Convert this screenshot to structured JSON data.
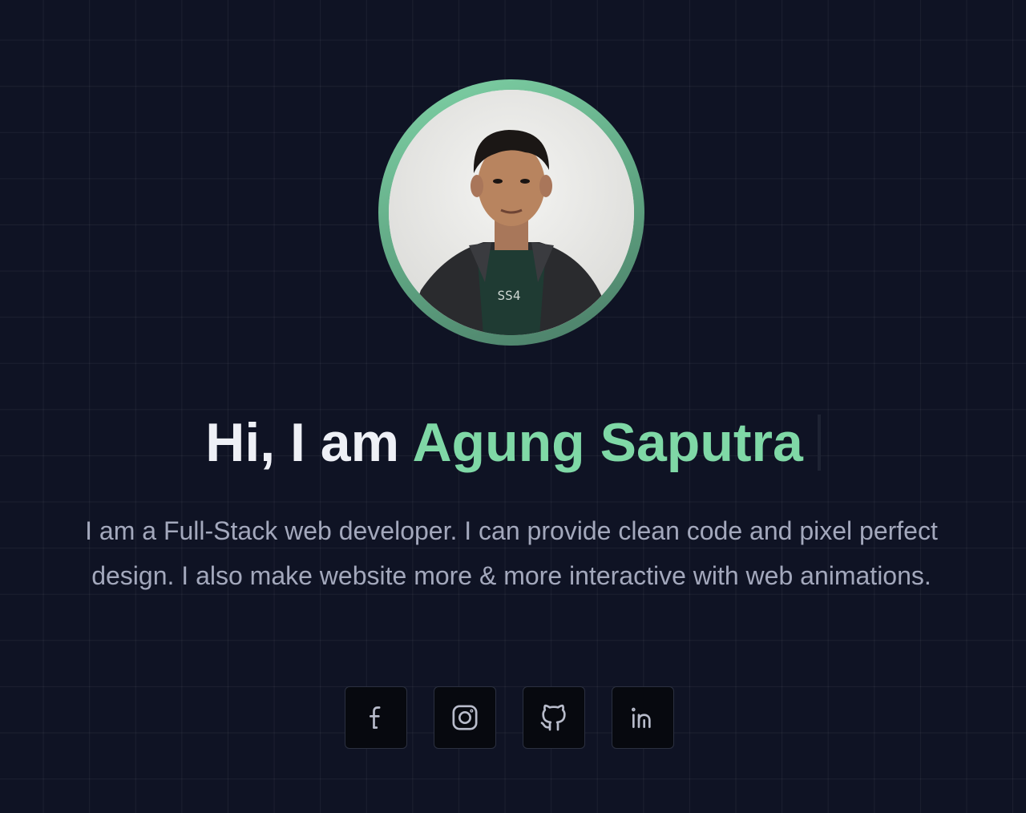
{
  "hero": {
    "avatar_alt": "Agung Saputra",
    "greeting": "Hi, I am",
    "name": "Agung Saputra",
    "intro": "I am a Full-Stack web developer. I can provide clean code and pixel perfect design. I also make website more & more interactive with web animations.",
    "colors": {
      "accent": "#7fd8a6",
      "background": "#0f1324",
      "text": "#eef0f6",
      "muted": "#a3a8bc"
    }
  },
  "socials": [
    {
      "icon": "facebook-icon"
    },
    {
      "icon": "instagram-icon"
    },
    {
      "icon": "github-icon"
    },
    {
      "icon": "linkedin-icon"
    }
  ]
}
